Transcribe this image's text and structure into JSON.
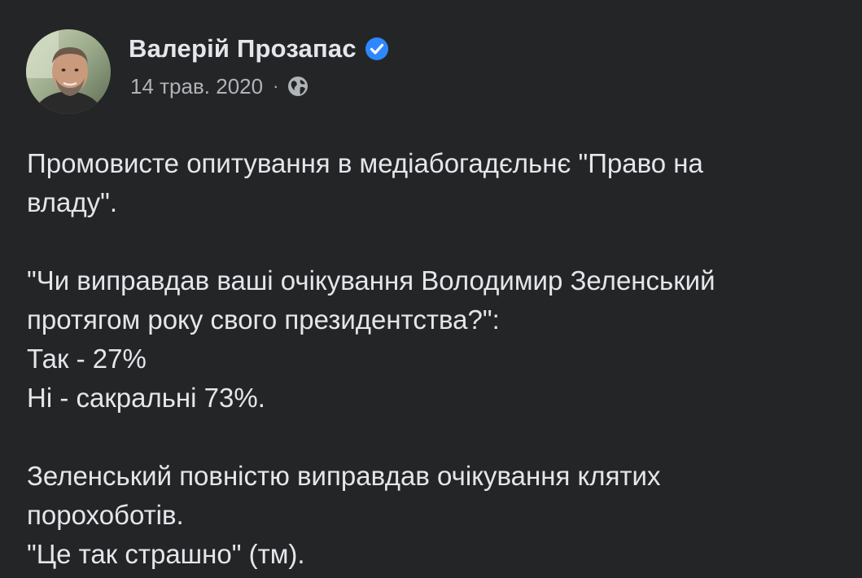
{
  "author": {
    "name": "Валерій Прозапас",
    "verified_icon": "verified-badge-icon",
    "verified_color": "#2d88ff"
  },
  "meta": {
    "date": "14 трав. 2020",
    "separator": "·",
    "audience_icon": "globe-icon"
  },
  "post": {
    "paragraphs": [
      {
        "lines": [
          "Промовисте опитування в медіабогадєльнє \"Право на",
          "владу\"."
        ]
      },
      {
        "lines": [
          "\"Чи виправдав ваші очікування Володимир Зеленський",
          "протягом року свого президентства?\":",
          "Так - 27%",
          "Ні - сакральні 73%."
        ]
      },
      {
        "lines": [
          "Зеленський повністю виправдав очікування клятих",
          "порохоботів.",
          "\"Це так страшно\" (тм)."
        ]
      }
    ]
  },
  "colors": {
    "background": "#242526",
    "primary_text": "#e4e6eb",
    "secondary_text": "#b0b3b8"
  }
}
